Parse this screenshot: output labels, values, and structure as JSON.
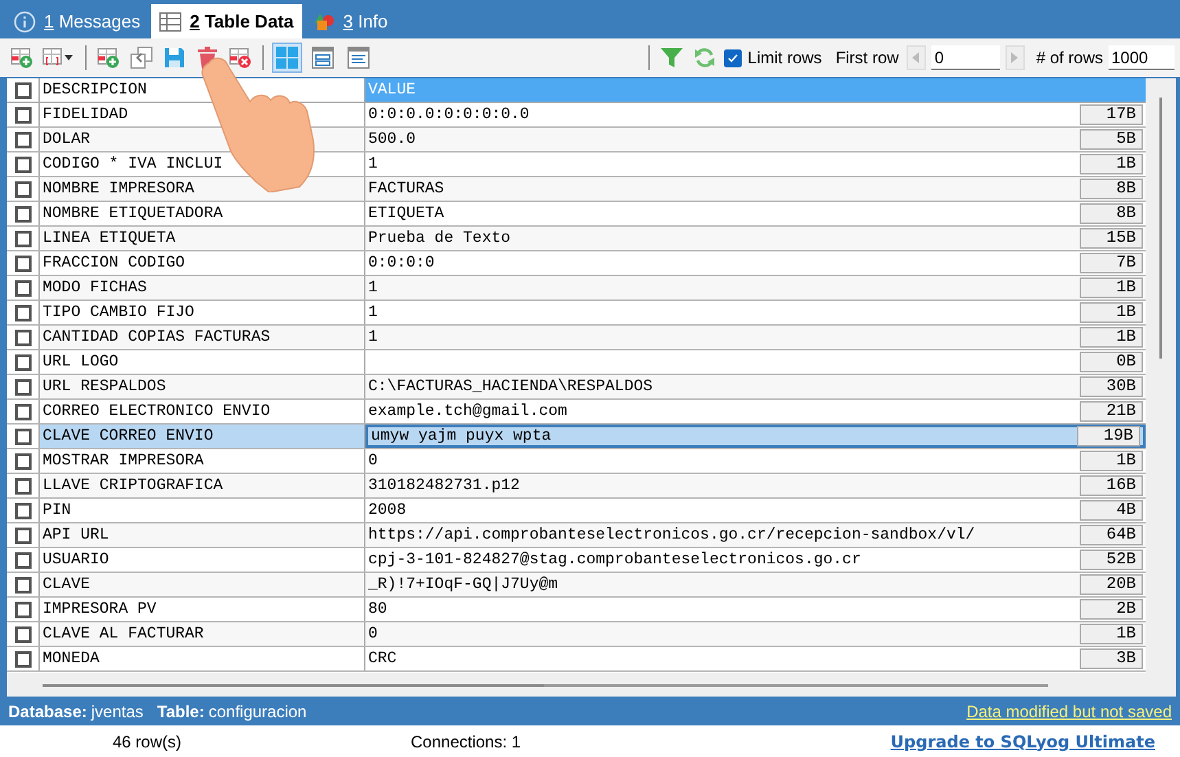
{
  "tabs": [
    {
      "kind": "info",
      "number": "1",
      "label": "Messages",
      "selected": false
    },
    {
      "kind": "table",
      "number": "2",
      "label": "Table Data",
      "selected": true
    },
    {
      "kind": "shapes",
      "number": "3",
      "label": "Info",
      "selected": false
    }
  ],
  "toolbar": {
    "view_modes": [
      {
        "kind": "grid",
        "selected": true
      },
      {
        "kind": "form",
        "selected": false
      },
      {
        "kind": "text",
        "selected": false
      }
    ],
    "limit_rows": {
      "label": "Limit rows",
      "checked": true
    },
    "first_row": {
      "label": "First row",
      "value": "0"
    },
    "row_count": {
      "label": "# of rows",
      "value": "1000"
    }
  },
  "table": {
    "header_checkbox": {
      "checked": false
    },
    "columns": [
      "DESCRIPCION",
      "VALUE"
    ],
    "rows": [
      {
        "checked": false,
        "selected": false,
        "description": "FIDELIDAD",
        "value": "0:0:0.0:0:0:0:0.0",
        "size": "17B"
      },
      {
        "checked": false,
        "selected": false,
        "description": "DOLAR",
        "value": "500.0",
        "size": "5B"
      },
      {
        "checked": false,
        "selected": false,
        "description": "CODIGO * IVA INCLUI",
        "value": "1",
        "size": "1B"
      },
      {
        "checked": false,
        "selected": false,
        "description": "NOMBRE IMPRESORA",
        "value": "FACTURAS",
        "size": "8B"
      },
      {
        "checked": false,
        "selected": false,
        "description": "NOMBRE ETIQUETADORA",
        "value": "ETIQUETA",
        "size": "8B"
      },
      {
        "checked": false,
        "selected": false,
        "description": "LINEA ETIQUETA",
        "value": "Prueba de Texto",
        "size": "15B"
      },
      {
        "checked": false,
        "selected": false,
        "description": "FRACCION CODIGO",
        "value": "0:0:0:0",
        "size": "7B"
      },
      {
        "checked": false,
        "selected": false,
        "description": "MODO FICHAS",
        "value": "1",
        "size": "1B"
      },
      {
        "checked": false,
        "selected": false,
        "description": "TIPO CAMBIO FIJO",
        "value": "1",
        "size": "1B"
      },
      {
        "checked": false,
        "selected": false,
        "description": "CANTIDAD COPIAS FACTURAS",
        "value": "1",
        "size": "1B"
      },
      {
        "checked": false,
        "selected": false,
        "description": "URL LOGO",
        "size": "0B"
      },
      {
        "checked": false,
        "selected": false,
        "description": "URL RESPALDOS",
        "value": "C:\\FACTURAS_HACIENDA\\RESPALDOS",
        "size": "30B"
      },
      {
        "checked": false,
        "selected": false,
        "description": "CORREO ELECTRONICO ENVIO",
        "value": "example.tch@gmail.com",
        "size": "21B"
      },
      {
        "checked": false,
        "selected": true,
        "description": "CLAVE CORREO ENVIO",
        "value": "umyw yajm puyx wpta",
        "size": "19B"
      },
      {
        "checked": false,
        "selected": false,
        "description": "MOSTRAR IMPRESORA",
        "value": "0",
        "size": "1B"
      },
      {
        "checked": false,
        "selected": false,
        "description": "LLAVE CRIPTOGRAFICA",
        "value": "310182482731.p12",
        "size": "16B"
      },
      {
        "checked": false,
        "selected": false,
        "description": "PIN",
        "value": "2008",
        "size": "4B"
      },
      {
        "checked": false,
        "selected": false,
        "description": "API URL",
        "value": "https://api.comprobanteselectronicos.go.cr/recepcion-sandbox/vl/",
        "size": "64B"
      },
      {
        "checked": false,
        "selected": false,
        "description": "USUARIO",
        "value": "cpj-3-101-824827@stag.comprobanteselectronicos.go.cr",
        "size": "52B"
      },
      {
        "checked": false,
        "selected": false,
        "description": "CLAVE",
        "value": "_R)!7+IOqF-GQ|J7Uy@m",
        "size": "20B"
      },
      {
        "checked": false,
        "selected": false,
        "description": "IMPRESORA PV",
        "value": "80",
        "size": "2B"
      },
      {
        "checked": false,
        "selected": false,
        "description": "CLAVE AL FACTURAR",
        "value": "0",
        "size": "1B"
      },
      {
        "checked": false,
        "selected": false,
        "description": "MONEDA",
        "value": "CRC",
        "size": "3B"
      }
    ]
  },
  "status_bar": {
    "database_label": "Database:",
    "database": "jventas",
    "table_label": "Table:",
    "table": "configuracion",
    "notice": "Data modified but not saved"
  },
  "footer": {
    "rows": "46 row(s)",
    "connections": "Connections: 1",
    "upgrade_link": "Upgrade to SQLyog Ultimate"
  }
}
